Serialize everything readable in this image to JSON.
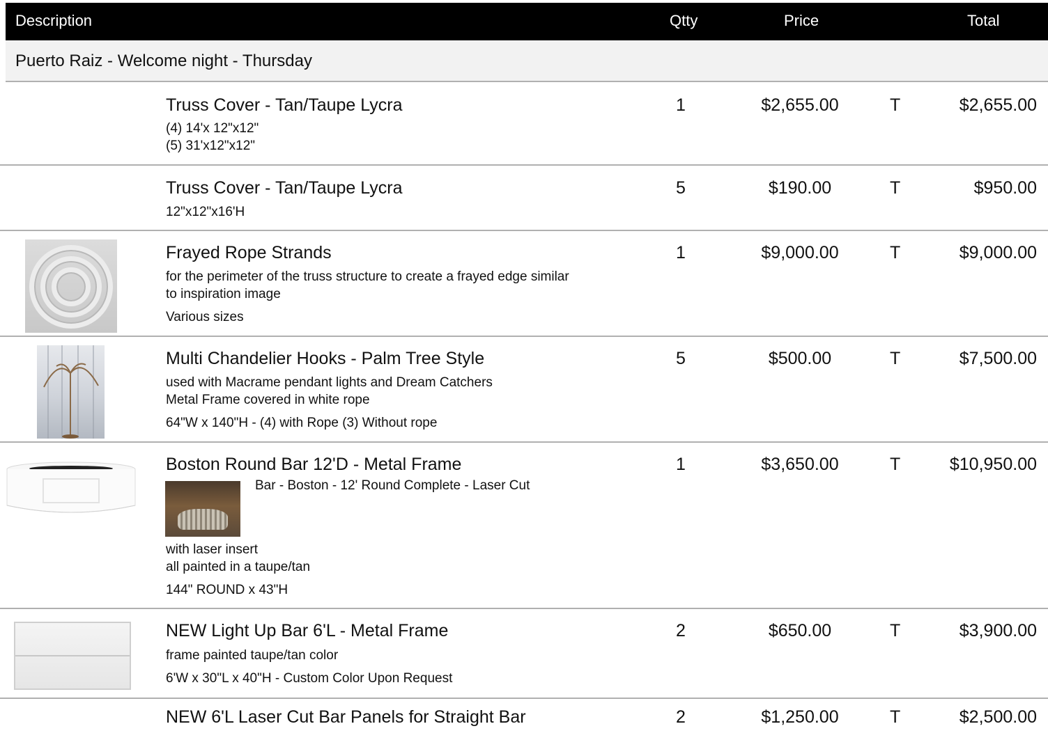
{
  "header": {
    "description": "Description",
    "qty": "Qtty",
    "price": "Price",
    "total": "Total"
  },
  "section": {
    "title": "Puerto Raiz - Welcome night - Thursday"
  },
  "items": [
    {
      "name": "Truss Cover - Tan/Taupe Lycra",
      "qty": "1",
      "price": "$2,655.00",
      "tax": "T",
      "total": "$2,655.00",
      "lines": [
        "(4) 14'x 12\"x12\"",
        "(5) 31'x12\"x12\""
      ]
    },
    {
      "name": "Truss Cover - Tan/Taupe Lycra",
      "qty": "5",
      "price": "$190.00",
      "tax": "T",
      "total": "$950.00",
      "lines": [
        "12\"x12\"x16'H"
      ]
    },
    {
      "name": "Frayed Rope Strands",
      "qty": "1",
      "price": "$9,000.00",
      "tax": "T",
      "total": "$9,000.00",
      "lines": [
        "for the perimeter of the truss structure to create a frayed edge similar",
        "to inspiration image",
        "Various sizes"
      ],
      "image": "rope-coil-image"
    },
    {
      "name": "Multi Chandelier Hooks - Palm Tree Style",
      "qty": "5",
      "price": "$500.00",
      "tax": "T",
      "total": "$7,500.00",
      "lines": [
        "used with Macrame pendant lights and Dream Catchers",
        "Metal Frame covered in white rope",
        "64\"W x 140\"H - (4) with Rope (3) Without rope"
      ],
      "image": "palm-tree-hook-image"
    },
    {
      "name": "Boston Round Bar 12'D - Metal Frame",
      "qty": "1",
      "price": "$3,650.00",
      "tax": "T",
      "total": "$10,950.00",
      "inline_caption": "Bar - Boston - 12' Round Complete - Laser Cut",
      "lines": [
        "with laser insert",
        "all painted in a taupe/tan",
        "144\" ROUND x 43\"H"
      ],
      "image": "round-bar-image"
    },
    {
      "name": "NEW Light Up Bar 6'L - Metal Frame",
      "qty": "2",
      "price": "$650.00",
      "tax": "T",
      "total": "$3,900.00",
      "lines": [
        "frame painted taupe/tan color",
        "6'W x 30\"L x 40\"H - Custom Color Upon Request"
      ],
      "image": "light-up-bar-image"
    },
    {
      "name": "NEW 6'L Laser Cut Bar Panels for Straight Bar",
      "qty": "2",
      "price": "$1,250.00",
      "tax": "T",
      "total": "$2,500.00",
      "lines": []
    }
  ]
}
